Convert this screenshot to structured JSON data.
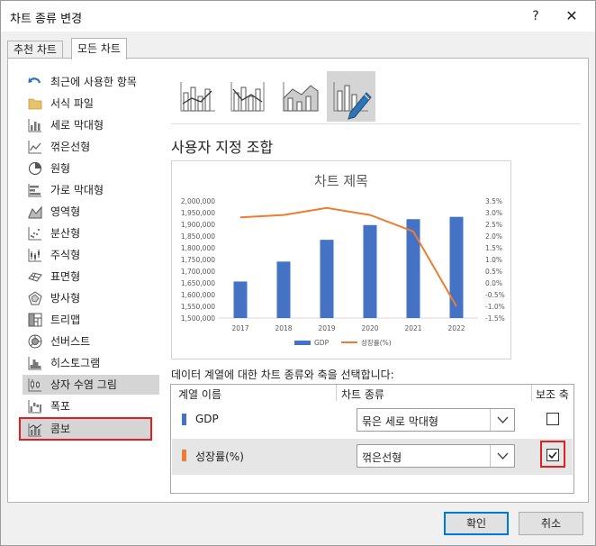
{
  "window": {
    "title": "차트 종류 변경",
    "help": "?",
    "close": "✕"
  },
  "tabs": [
    {
      "label": "추천 차트"
    },
    {
      "label": "모든 차트"
    }
  ],
  "sidebar": {
    "items": [
      {
        "label": "최근에 사용한 항목",
        "icon": "undo-arrow-icon"
      },
      {
        "label": "서식 파일",
        "icon": "folder-icon"
      },
      {
        "label": "세로 막대형",
        "icon": "column-chart-icon"
      },
      {
        "label": "꺾은선형",
        "icon": "line-chart-icon"
      },
      {
        "label": "원형",
        "icon": "pie-chart-icon"
      },
      {
        "label": "가로 막대형",
        "icon": "bar-chart-icon"
      },
      {
        "label": "영역형",
        "icon": "area-chart-icon"
      },
      {
        "label": "분산형",
        "icon": "scatter-chart-icon"
      },
      {
        "label": "주식형",
        "icon": "stock-chart-icon"
      },
      {
        "label": "표면형",
        "icon": "surface-chart-icon"
      },
      {
        "label": "방사형",
        "icon": "radar-chart-icon"
      },
      {
        "label": "트리맵",
        "icon": "treemap-icon"
      },
      {
        "label": "선버스트",
        "icon": "sunburst-icon"
      },
      {
        "label": "히스토그램",
        "icon": "histogram-icon"
      },
      {
        "label": "상자 수염 그림",
        "icon": "box-whisker-icon"
      },
      {
        "label": "폭포",
        "icon": "waterfall-icon"
      },
      {
        "label": "콤보",
        "icon": "combo-chart-icon"
      }
    ]
  },
  "combo_title": "사용자 지정 조합",
  "series_hint": "데이터 계열에 대한 차트 종류와 축을 선택합니다:",
  "series_table": {
    "headers": {
      "name": "계열 이름",
      "type": "차트 종류",
      "axis": "보조 축"
    },
    "rows": [
      {
        "name": "GDP",
        "type": "묶은 세로 막대형",
        "secondary_axis": false,
        "color": "#4472c4"
      },
      {
        "name": "성장률(%)",
        "type": "꺾은선형",
        "secondary_axis": true,
        "color": "#ed7d31"
      }
    ]
  },
  "buttons": {
    "ok": "확인",
    "cancel": "취소"
  },
  "chart_data": {
    "type": "bar",
    "title": "차트 제목",
    "categories": [
      "2017",
      "2018",
      "2019",
      "2020",
      "2021",
      "2022"
    ],
    "series": [
      {
        "name": "GDP",
        "type": "bar",
        "axis": "primary",
        "color": "#4472c4",
        "values": [
          1656000,
          1741000,
          1834000,
          1897000,
          1922000,
          1932000
        ]
      },
      {
        "name": "성장률(%)",
        "type": "line",
        "axis": "secondary",
        "color": "#ed7d31",
        "values": [
          2.8,
          2.9,
          3.2,
          2.9,
          2.2,
          -1.0
        ]
      }
    ],
    "y_primary": {
      "ylim": [
        1500000,
        2000000
      ],
      "ticks": [
        "1,500,000",
        "1,550,000",
        "1,600,000",
        "1,650,000",
        "1,700,000",
        "1,750,000",
        "1,800,000",
        "1,850,000",
        "1,900,000",
        "1,950,000",
        "2,000,000"
      ]
    },
    "y_secondary": {
      "ylim": [
        -1.5,
        3.5
      ],
      "ticks": [
        "-1.5%",
        "-1.0%",
        "-0.5%",
        "0.0%",
        "0.5%",
        "1.0%",
        "1.5%",
        "2.0%",
        "2.5%",
        "3.0%",
        "3.5%"
      ]
    },
    "legend": "bottom",
    "grid": false
  }
}
